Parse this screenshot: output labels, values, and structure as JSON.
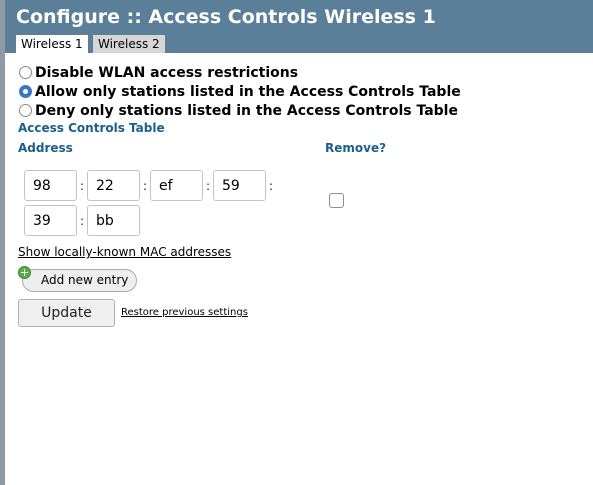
{
  "header": {
    "title": "Configure :: Access Controls Wireless 1",
    "tabs": [
      {
        "label": "Wireless 1",
        "active": true
      },
      {
        "label": "Wireless 2",
        "active": false
      }
    ]
  },
  "restriction_options": [
    {
      "label": "Disable WLAN access restrictions",
      "checked": false
    },
    {
      "label": "Allow only stations listed in the Access Controls Table",
      "checked": true
    },
    {
      "label": "Deny only stations listed in the Access Controls Table",
      "checked": false
    }
  ],
  "table": {
    "title": "Access Controls Table",
    "address_header": "Address",
    "remove_header": "Remove?",
    "octet_separator": ":",
    "mac_octets": [
      "98",
      "22",
      "ef",
      "59",
      "39",
      "bb"
    ],
    "remove_checked": false
  },
  "links": {
    "show_mac": "Show locally-known MAC addresses",
    "restore": "Restore previous settings"
  },
  "buttons": {
    "add_entry": "Add new entry",
    "update": "Update"
  },
  "colors": {
    "header_bg": "#5b7f99",
    "section_label": "#1b5e8c",
    "radio_checked": "#3a77c9"
  }
}
